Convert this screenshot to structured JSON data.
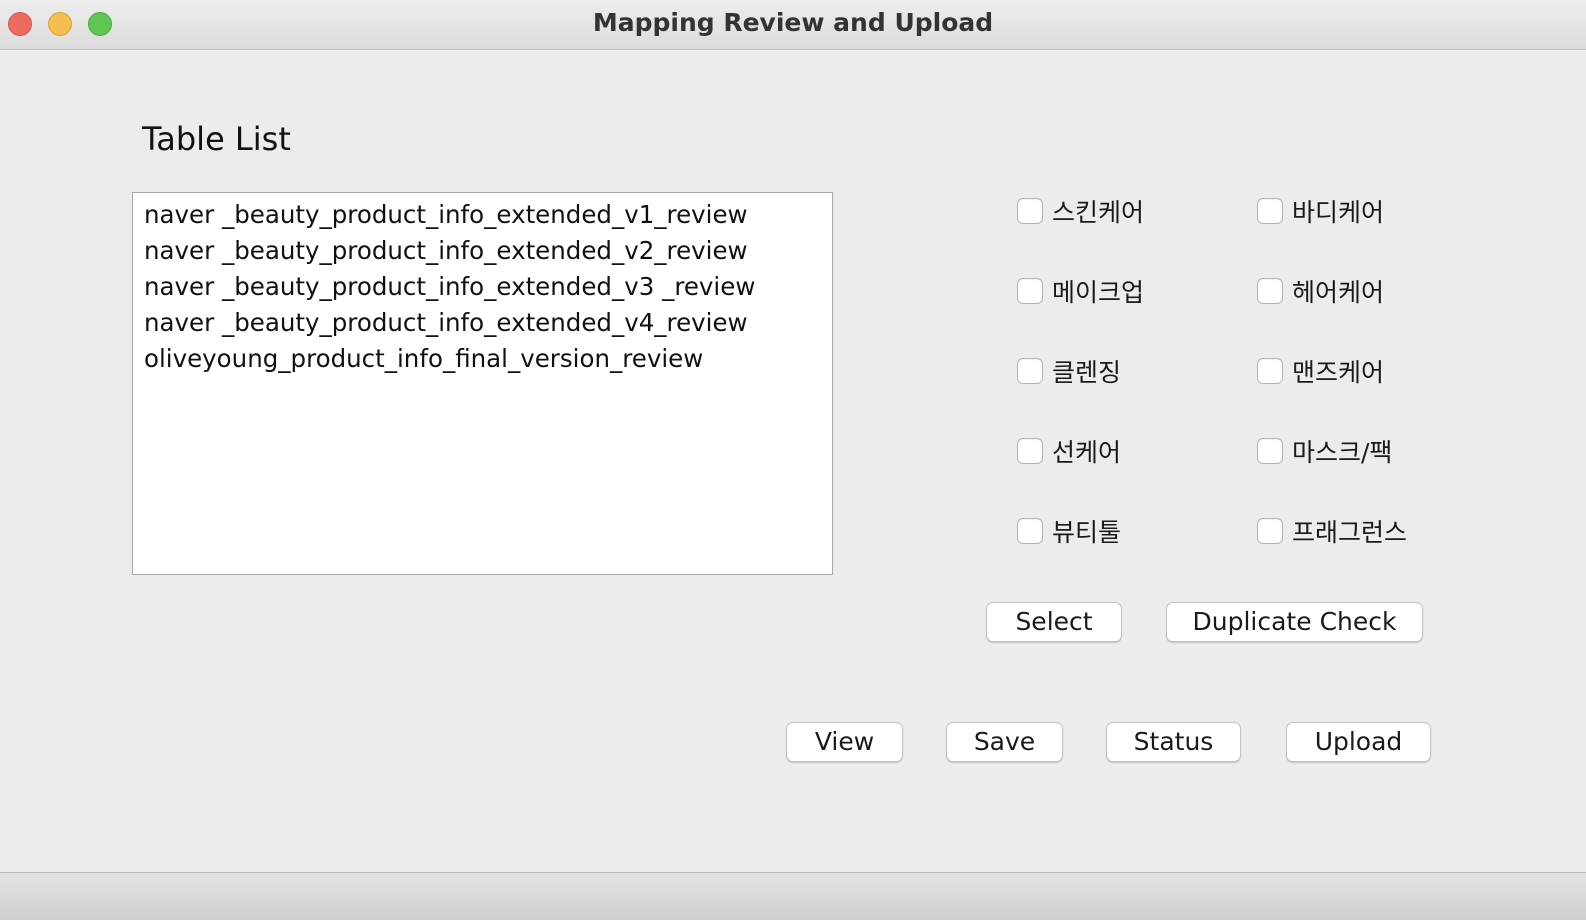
{
  "window": {
    "title": "Mapping Review and Upload"
  },
  "table_list": {
    "label": "Table List",
    "items": [
      "naver _beauty_product_info_extended_v1_review",
      "naver _beauty_product_info_extended_v2_review",
      "naver _beauty_product_info_extended_v3 _review",
      "naver _beauty_product_info_extended_v4_review",
      "oliveyoung_product_info_final_version_review"
    ]
  },
  "categories": {
    "left": [
      "스킨케어",
      "메이크업",
      "클렌징",
      "선케어",
      "뷰티툴"
    ],
    "right": [
      "바디케어",
      "헤어케어",
      "맨즈케어",
      "마스크/팩",
      "프래그런스"
    ],
    "all_checked": false
  },
  "buttons": {
    "select": "Select",
    "duplicate_check": "Duplicate Check",
    "view": "View",
    "save": "Save",
    "status": "Status",
    "upload": "Upload"
  },
  "colors": {
    "window_bg": "#ececec",
    "close": "#ed6a5e",
    "minimize": "#f5bf4f",
    "maximize": "#61c554"
  }
}
